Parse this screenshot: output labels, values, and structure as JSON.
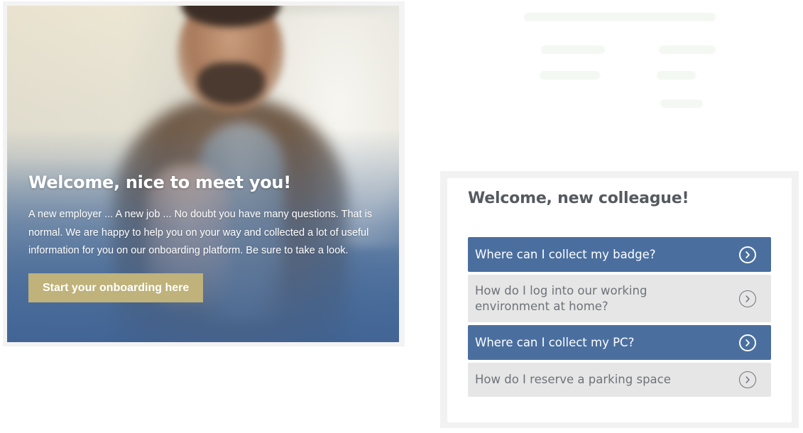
{
  "hero": {
    "title": "Welcome, nice to meet you!",
    "body": "A new employer ... A new job ... No doubt you have many questions. That is normal. We are happy to help you on your way and collected a lot of useful information for you on our onboarding platform. Be sure to take a look.",
    "cta_label": "Start your onboarding here",
    "cta_color": "#bfb27a"
  },
  "faq": {
    "title": "Welcome, new colleague!",
    "accent_color": "#4a6f9f",
    "items": [
      {
        "label": "Where can I collect my badge?",
        "state": "active",
        "icon": "chevron-right-circle-icon"
      },
      {
        "label": "How do I log into our working environment at home?",
        "state": "idle",
        "icon": "chevron-right-circle-icon"
      },
      {
        "label": "Where can I collect my PC?",
        "state": "active",
        "icon": "chevron-right-circle-icon"
      },
      {
        "label": "How do I reserve a parking space",
        "state": "idle",
        "icon": "chevron-right-circle-icon"
      }
    ]
  }
}
